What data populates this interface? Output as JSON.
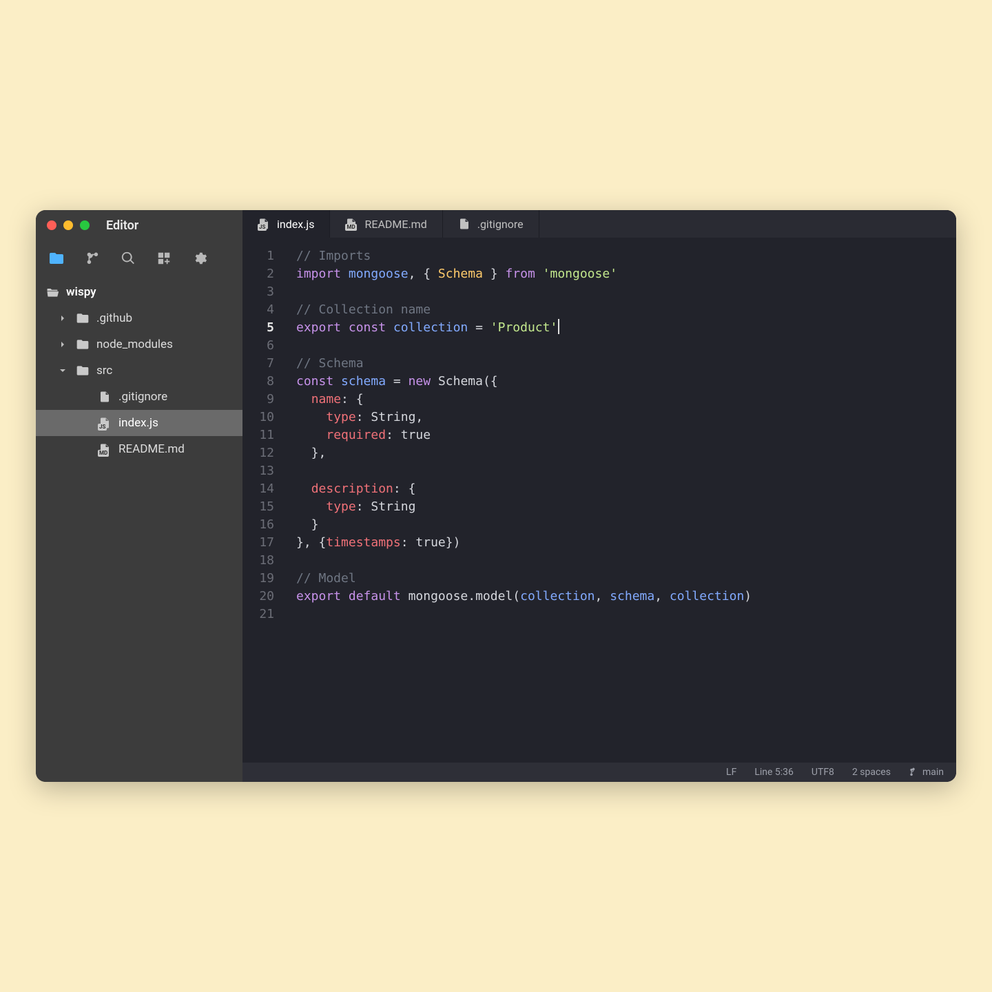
{
  "app": {
    "title": "Editor"
  },
  "sidebar": {
    "root": "wispy",
    "items": [
      {
        "label": ".github",
        "icon": "folder",
        "chev": "right",
        "depth": 1
      },
      {
        "label": "node_modules",
        "icon": "folder",
        "chev": "right",
        "depth": 1
      },
      {
        "label": "src",
        "icon": "folder",
        "chev": "down",
        "depth": 1
      },
      {
        "label": ".gitignore",
        "icon": "file",
        "depth": 2
      },
      {
        "label": "index.js",
        "icon": "js",
        "depth": 2,
        "selected": true
      },
      {
        "label": "README.md",
        "icon": "md",
        "depth": 2
      }
    ]
  },
  "tabs": [
    {
      "label": "index.js",
      "icon": "js",
      "active": true
    },
    {
      "label": "README.md",
      "icon": "md"
    },
    {
      "label": ".gitignore",
      "icon": "file"
    }
  ],
  "code": [
    [
      {
        "t": "// Imports",
        "c": "comment"
      }
    ],
    [
      {
        "t": "import ",
        "c": "keyword"
      },
      {
        "t": "mongoose",
        "c": "attr"
      },
      {
        "t": ", { "
      },
      {
        "t": "Schema",
        "c": "class"
      },
      {
        "t": " } "
      },
      {
        "t": "from ",
        "c": "keyword"
      },
      {
        "t": "'mongoose'",
        "c": "string"
      }
    ],
    [],
    [
      {
        "t": "// Collection name",
        "c": "comment"
      }
    ],
    [
      {
        "t": "export ",
        "c": "keyword"
      },
      {
        "t": "const ",
        "c": "keyword"
      },
      {
        "t": "collection",
        "c": "attr"
      },
      {
        "t": " = "
      },
      {
        "t": "'Product'",
        "c": "string"
      },
      {
        "cursor": true
      }
    ],
    [],
    [
      {
        "t": "// Schema",
        "c": "comment"
      }
    ],
    [
      {
        "t": "const ",
        "c": "keyword"
      },
      {
        "t": "schema",
        "c": "attr"
      },
      {
        "t": " = "
      },
      {
        "t": "new ",
        "c": "keyword"
      },
      {
        "t": "Schema({",
        "c": ""
      }
    ],
    [
      {
        "t": "  "
      },
      {
        "t": "name",
        "c": "prop"
      },
      {
        "t": ": {"
      }
    ],
    [
      {
        "t": "    "
      },
      {
        "t": "type",
        "c": "prop"
      },
      {
        "t": ": String,"
      }
    ],
    [
      {
        "t": "    "
      },
      {
        "t": "required",
        "c": "prop"
      },
      {
        "t": ": true"
      }
    ],
    [
      {
        "t": "  },"
      }
    ],
    [],
    [
      {
        "t": "  "
      },
      {
        "t": "description",
        "c": "prop"
      },
      {
        "t": ": {"
      }
    ],
    [
      {
        "t": "    "
      },
      {
        "t": "type",
        "c": "prop"
      },
      {
        "t": ": String"
      }
    ],
    [
      {
        "t": "  }"
      }
    ],
    [
      {
        "t": "}, {"
      },
      {
        "t": "timestamps",
        "c": "prop"
      },
      {
        "t": ": true})"
      }
    ],
    [],
    [
      {
        "t": "// Model",
        "c": "comment"
      }
    ],
    [
      {
        "t": "export ",
        "c": "keyword"
      },
      {
        "t": "default ",
        "c": "keyword"
      },
      {
        "t": "mongoose.model("
      },
      {
        "t": "collection",
        "c": "attr"
      },
      {
        "t": ", "
      },
      {
        "t": "schema",
        "c": "attr"
      },
      {
        "t": ", "
      },
      {
        "t": "collection",
        "c": "attr"
      },
      {
        "t": ")"
      }
    ],
    []
  ],
  "cursor_line": 5,
  "status": {
    "eol": "LF",
    "pos": "Line 5:36",
    "encoding": "UTF8",
    "indent": "2 spaces",
    "branch": "main"
  }
}
